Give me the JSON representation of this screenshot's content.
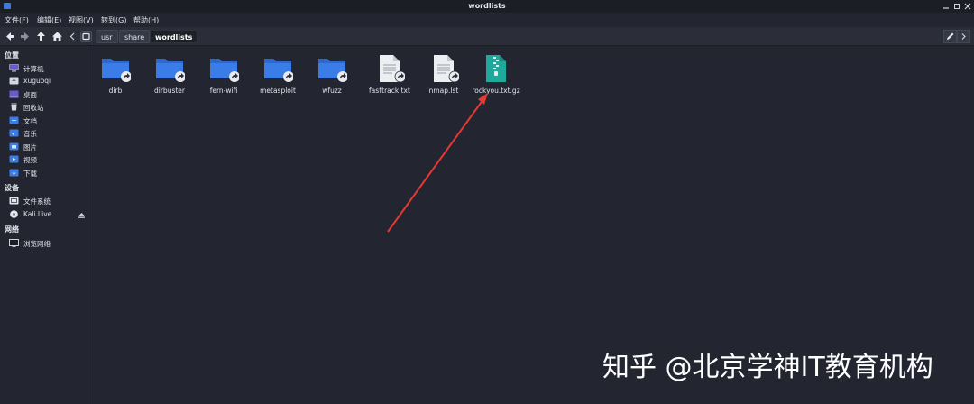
{
  "window": {
    "title": "wordlists"
  },
  "menu": [
    "文件(F)",
    "编辑(E)",
    "视图(V)",
    "转到(G)",
    "帮助(H)"
  ],
  "breadcrumb": [
    "usr",
    "share",
    "wordlists"
  ],
  "sidebar": {
    "places_heading": "位置",
    "places": [
      {
        "label": "计算机",
        "icon": "computer-icon"
      },
      {
        "label": "xuguoqi",
        "icon": "home-folder-icon"
      },
      {
        "label": "桌面",
        "icon": "desktop-icon"
      },
      {
        "label": "回收站",
        "icon": "trash-icon"
      },
      {
        "label": "文档",
        "icon": "documents-folder-icon"
      },
      {
        "label": "音乐",
        "icon": "music-folder-icon"
      },
      {
        "label": "图片",
        "icon": "pictures-folder-icon"
      },
      {
        "label": "视频",
        "icon": "videos-folder-icon"
      },
      {
        "label": "下载",
        "icon": "downloads-folder-icon"
      }
    ],
    "devices_heading": "设备",
    "devices": [
      {
        "label": "文件系统",
        "icon": "drive-icon"
      },
      {
        "label": "Kali Live",
        "icon": "disc-icon"
      }
    ],
    "network_heading": "网络",
    "network": [
      {
        "label": "浏览网络",
        "icon": "network-icon"
      }
    ]
  },
  "files": [
    {
      "name": "dirb",
      "type": "folder-link"
    },
    {
      "name": "dirbuster",
      "type": "folder-link"
    },
    {
      "name": "fern-wifi",
      "type": "folder-link"
    },
    {
      "name": "metasploit",
      "type": "folder-link"
    },
    {
      "name": "wfuzz",
      "type": "folder-link"
    },
    {
      "name": "fasttrack.txt",
      "type": "text-link"
    },
    {
      "name": "nmap.lst",
      "type": "text-link"
    },
    {
      "name": "rockyou.txt.gz",
      "type": "archive"
    }
  ],
  "watermark": "知乎 @北京学神IT教育机构",
  "colors": {
    "background": "#232630",
    "folder": "#3b7de8",
    "archive": "#1fa89c",
    "annotation_arrow": "#e53935"
  }
}
